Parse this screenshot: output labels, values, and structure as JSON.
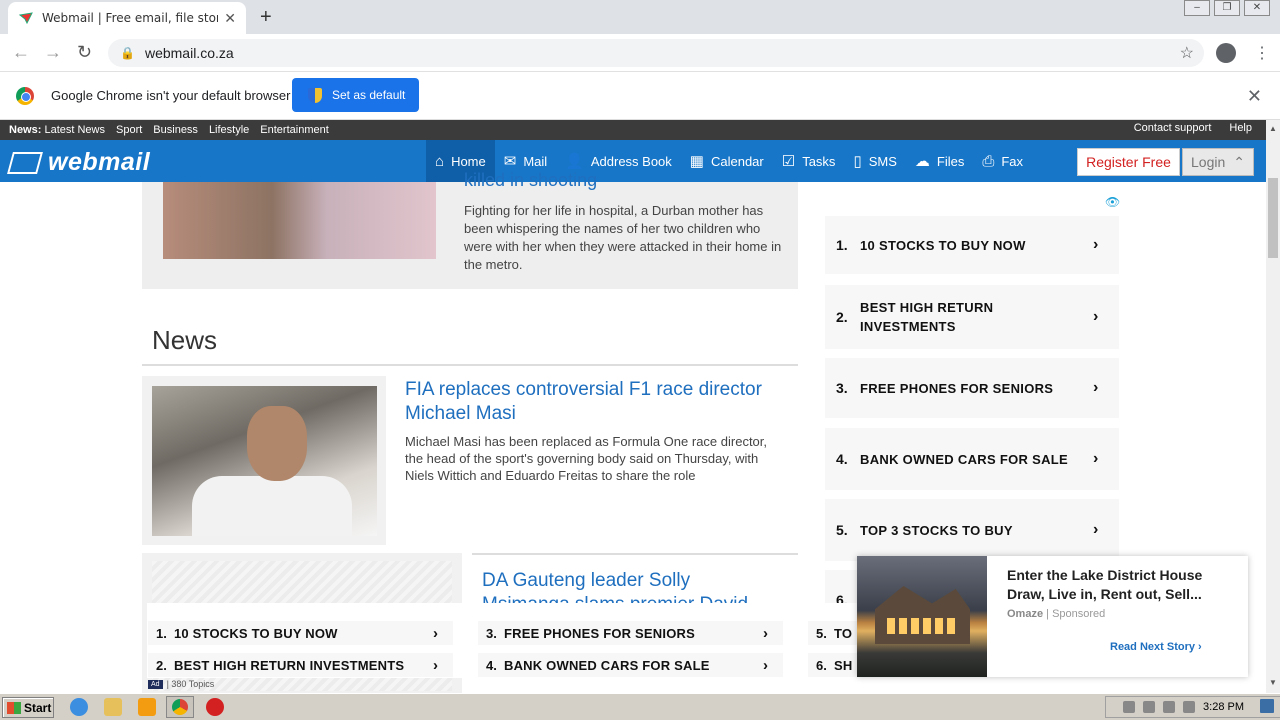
{
  "browser": {
    "tab_title": "Webmail | Free email, file storage, sms",
    "tab_close": "✕",
    "new_tab": "+",
    "url": "webmail.co.za",
    "infobar_message": "Google Chrome isn't your default browser",
    "set_default_label": "Set as default",
    "infobar_close": "✕"
  },
  "topbar": {
    "news_label": "News:",
    "news_links": [
      "Latest News",
      "Sport",
      "Business",
      "Lifestyle",
      "Entertainment"
    ],
    "contact": "Contact support",
    "help": "Help"
  },
  "nav": {
    "logo": "webmail",
    "items": [
      {
        "label": "Home",
        "icon": "home-icon",
        "glyph": "⌂"
      },
      {
        "label": "Mail",
        "icon": "mail-icon",
        "glyph": "✉"
      },
      {
        "label": "Address Book",
        "icon": "person-icon",
        "glyph": "👤"
      },
      {
        "label": "Calendar",
        "icon": "calendar-icon",
        "glyph": "▦"
      },
      {
        "label": "Tasks",
        "icon": "checkbox-icon",
        "glyph": "☑"
      },
      {
        "label": "SMS",
        "icon": "phone-icon",
        "glyph": "▯"
      },
      {
        "label": "Files",
        "icon": "cloud-icon",
        "glyph": "☁"
      },
      {
        "label": "Fax",
        "icon": "fax-icon",
        "glyph": "⎙"
      }
    ],
    "register": "Register Free",
    "login": "Login"
  },
  "featured": {
    "headline_partial": "killed in shooting",
    "summary": "Fighting for her life in hospital, a Durban mother has been whispering the names of her two children who were with her when they were attacked in their home in the metro."
  },
  "news": {
    "heading": "News",
    "article_title": "FIA replaces controversial F1 race director Michael Masi",
    "article_body": "Michael Masi has been replaced as Formula One race director, the head of the sport's governing body said on Thursday, with Niels Wittich and Eduardo Freitas to share the role",
    "second_title": "DA Gauteng leader Solly Msimanga slams premier David"
  },
  "sidebar_ads": [
    {
      "num": "1.",
      "text": "10 STOCKS TO BUY NOW"
    },
    {
      "num": "2.",
      "text": "BEST HIGH RETURN INVESTMENTS"
    },
    {
      "num": "3.",
      "text": "FREE PHONES FOR SENIORS"
    },
    {
      "num": "4.",
      "text": "BANK OWNED CARS FOR SALE"
    },
    {
      "num": "5.",
      "text": "TOP 3 STOCKS TO BUY"
    },
    {
      "num": "6.",
      "text": ""
    }
  ],
  "bottom_ads": [
    {
      "num": "1.",
      "text": "10 STOCKS TO BUY NOW"
    },
    {
      "num": "2.",
      "text": "BEST HIGH RETURN INVESTMENTS"
    },
    {
      "num": "3.",
      "text": "FREE PHONES FOR SENIORS"
    },
    {
      "num": "4.",
      "text": "BANK OWNED CARS FOR SALE"
    },
    {
      "num": "5.",
      "text": "TO"
    },
    {
      "num": "6.",
      "text": "SH"
    }
  ],
  "topics": {
    "ad_badge": "Ad",
    "label": "| 380 Topics"
  },
  "popup": {
    "title": "Enter the Lake District House Draw, Live in, Rent out, Sell...",
    "source": "Omaze",
    "sponsored": "Sponsored",
    "read_next": "Read Next Story ›"
  },
  "taskbar": {
    "start": "Start",
    "time": "3:28 PM"
  }
}
